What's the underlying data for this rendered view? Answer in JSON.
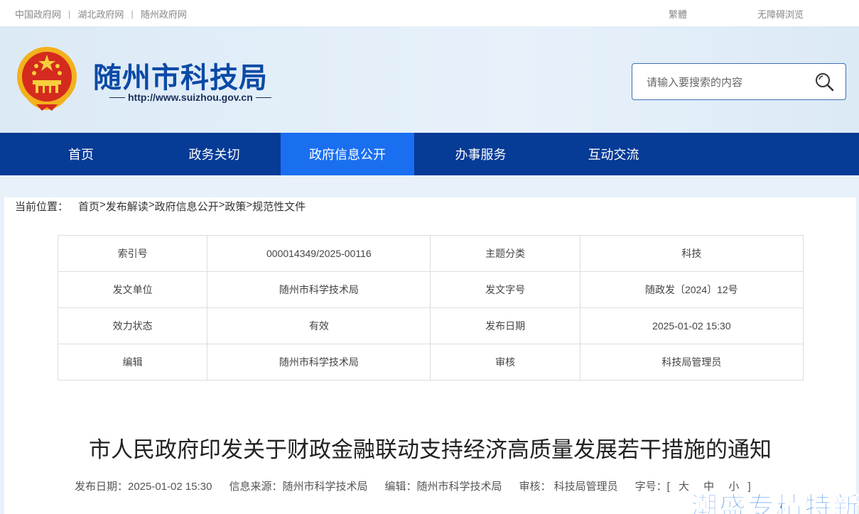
{
  "topbar": {
    "links": [
      "中国政府网",
      "湖北政府网",
      "随州政府网"
    ],
    "separator": "|",
    "traditional": "繁體",
    "accessibility": "无障碍浏览"
  },
  "header": {
    "site_title": "随州市科技局",
    "site_url": "http://www.suizhou.gov.cn"
  },
  "search": {
    "placeholder": "请输入要搜索的内容"
  },
  "nav": {
    "items": [
      "首页",
      "政务关切",
      "政府信息公开",
      "办事服务",
      "互动交流"
    ],
    "active_index": 2
  },
  "breadcrumb": {
    "label": "当前位置：",
    "path": [
      "首页",
      "发布解读",
      "政府信息公开",
      "政策",
      "规范性文件"
    ],
    "separator": ">"
  },
  "meta_table": {
    "rows": [
      [
        "索引号",
        "000014349/2025-00116",
        "主题分类",
        "科技"
      ],
      [
        "发文单位",
        "随州市科学技术局",
        "发文字号",
        "随政发〔2024〕12号"
      ],
      [
        "效力状态",
        "有效",
        "发布日期",
        "2025-01-02 15:30"
      ],
      [
        "编辑",
        "随州市科学技术局",
        "审核",
        "科技局管理员"
      ]
    ]
  },
  "article": {
    "title": "市人民政府印发关于财政金融联动支持经济高质量发展若干措施的通知",
    "publish_date": "发布日期：2025-01-02 15:30",
    "source": "信息来源：随州市科学技术局",
    "editor": "编辑：随州市科学技术局",
    "reviewer": "审核： 科技局管理员",
    "font_size_label": "字号：[",
    "font_sizes": [
      "大",
      "中",
      "小"
    ],
    "font_size_end": "]"
  },
  "watermark": "潮盛专精特新",
  "colors": {
    "nav_bg": "#063b96",
    "nav_active": "#1a6ff0",
    "title_blue": "#0b4aa6"
  }
}
